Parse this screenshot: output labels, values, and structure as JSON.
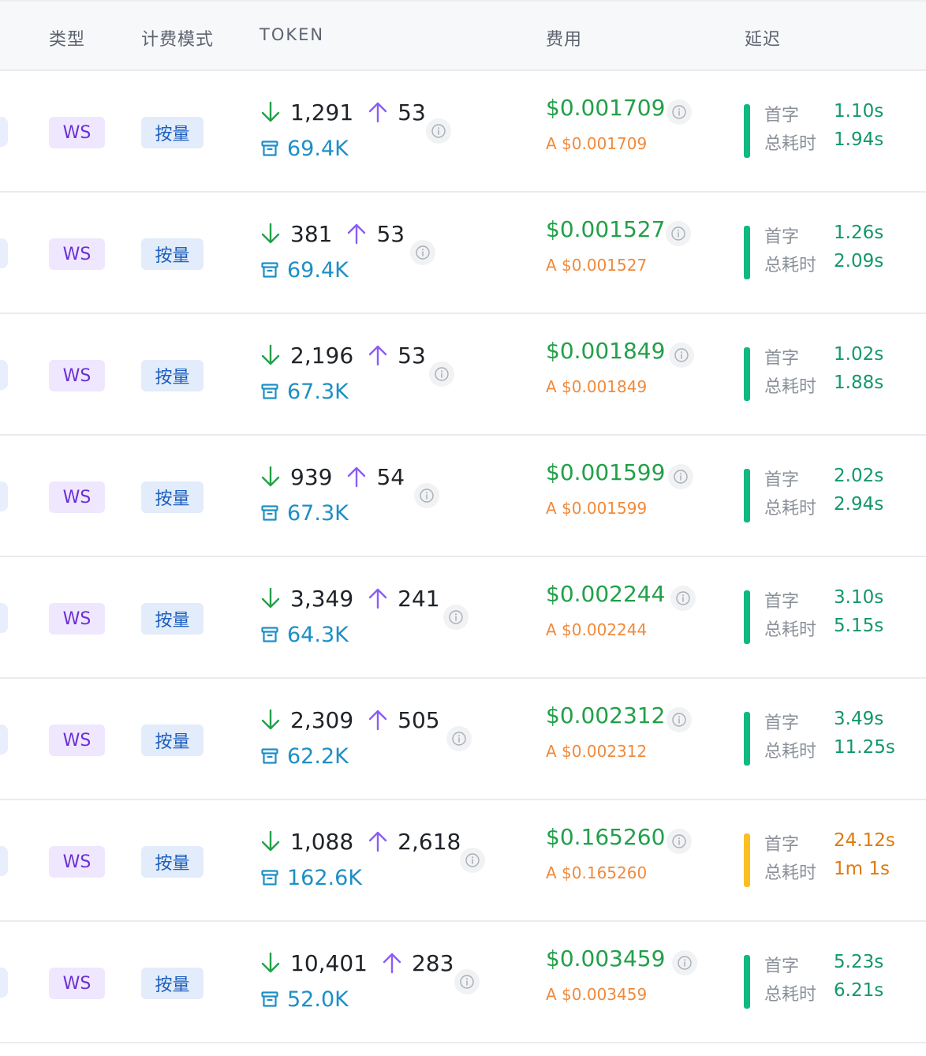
{
  "header": {
    "col_type": "类型",
    "col_billing": "计费模式",
    "col_token": "TOKEN",
    "col_cost": "费用",
    "col_latency": "延迟"
  },
  "labels": {
    "first_token": "首字",
    "total_time": "总耗时"
  },
  "colors": {
    "green": "#22a049",
    "latency_ok": "#10b981",
    "latency_warn": "#fbbf24",
    "purple": "#8b5cf6",
    "blue": "#1d8fc6",
    "orange": "#f08a3c"
  },
  "icons": {
    "input_tokens": "arrow-down-icon",
    "output_tokens": "arrow-up-icon",
    "cache_tokens": "archive-icon",
    "details": "info-icon"
  },
  "rows": [
    {
      "type": "WS",
      "mode": "按量",
      "in": "1,291",
      "out": "53",
      "cache": "69.4K",
      "cost": "$0.001709",
      "cost_a": "A $0.001709",
      "first": "1.10s",
      "total": "1.94s",
      "status": "ok"
    },
    {
      "type": "WS",
      "mode": "按量",
      "in": "381",
      "out": "53",
      "cache": "69.4K",
      "cost": "$0.001527",
      "cost_a": "A $0.001527",
      "first": "1.26s",
      "total": "2.09s",
      "status": "ok"
    },
    {
      "type": "WS",
      "mode": "按量",
      "in": "2,196",
      "out": "53",
      "cache": "67.3K",
      "cost": "$0.001849",
      "cost_a": "A $0.001849",
      "first": "1.02s",
      "total": "1.88s",
      "status": "ok"
    },
    {
      "type": "WS",
      "mode": "按量",
      "in": "939",
      "out": "54",
      "cache": "67.3K",
      "cost": "$0.001599",
      "cost_a": "A $0.001599",
      "first": "2.02s",
      "total": "2.94s",
      "status": "ok"
    },
    {
      "type": "WS",
      "mode": "按量",
      "in": "3,349",
      "out": "241",
      "cache": "64.3K",
      "cost": "$0.002244",
      "cost_a": "A $0.002244",
      "first": "3.10s",
      "total": "5.15s",
      "status": "ok"
    },
    {
      "type": "WS",
      "mode": "按量",
      "in": "2,309",
      "out": "505",
      "cache": "62.2K",
      "cost": "$0.002312",
      "cost_a": "A $0.002312",
      "first": "3.49s",
      "total": "11.25s",
      "status": "ok"
    },
    {
      "type": "WS",
      "mode": "按量",
      "in": "1,088",
      "out": "2,618",
      "cache": "162.6K",
      "cost": "$0.165260",
      "cost_a": "A $0.165260",
      "first": "24.12s",
      "total": "1m 1s",
      "status": "warn"
    },
    {
      "type": "WS",
      "mode": "按量",
      "in": "10,401",
      "out": "283",
      "cache": "52.0K",
      "cost": "$0.003459",
      "cost_a": "A $0.003459",
      "first": "5.23s",
      "total": "6.21s",
      "status": "ok"
    }
  ]
}
